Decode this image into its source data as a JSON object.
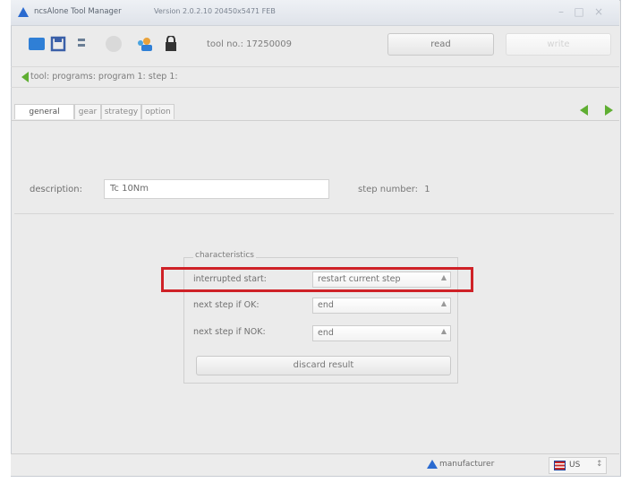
{
  "window": {
    "title": "ncsAlone Tool Manager",
    "version": "Version 2.0.2.10 20450x5471 FEB"
  },
  "toolbar": {
    "tool_no": "tool no.: 17250009",
    "read_label": "read",
    "write_label": "write"
  },
  "breadcrumb": "tool: programs: program 1: step 1:",
  "tabs": [
    {
      "label": "general",
      "active": true
    },
    {
      "label": "gear",
      "active": false
    },
    {
      "label": "strategy",
      "active": false
    },
    {
      "label": "option",
      "active": false
    }
  ],
  "general": {
    "description_label": "description:",
    "description_value": "Tc 10Nm",
    "step_number_label": "step number:",
    "step_number_value": "1"
  },
  "characteristics": {
    "legend": "characteristics",
    "rows": [
      {
        "label": "interrupted start:",
        "value": "restart current step"
      },
      {
        "label": "next step if OK:",
        "value": "end"
      },
      {
        "label": "next step if NOK:",
        "value": "end"
      }
    ],
    "discard_label": "discard result"
  },
  "status": {
    "user": "manufacturer",
    "language": "US"
  },
  "colors": {
    "highlight": "#cf2127",
    "accent_green": "#5fae32",
    "icon_blue": "#2a6ad0"
  }
}
